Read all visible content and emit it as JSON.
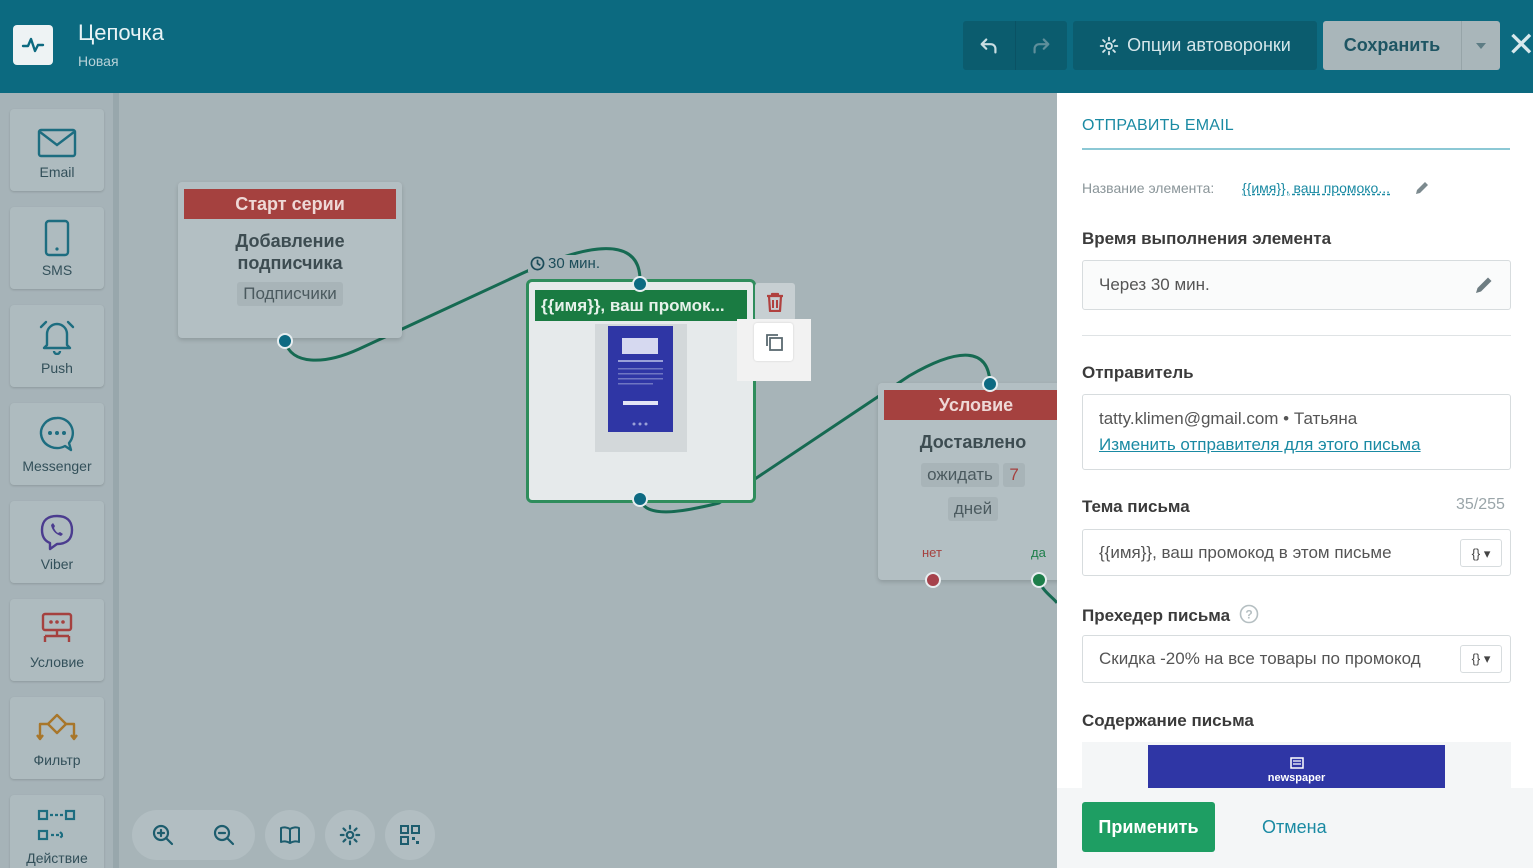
{
  "header": {
    "title": "Цепочка",
    "subtitle": "Новая",
    "options_label": "Опции автоворонки",
    "save_label": "Сохранить"
  },
  "sidebar": {
    "items": [
      {
        "label": "Email",
        "icon": "envelope-icon"
      },
      {
        "label": "SMS",
        "icon": "phone-icon"
      },
      {
        "label": "Push",
        "icon": "bell-icon"
      },
      {
        "label": "Messenger",
        "icon": "chat-bubble-icon"
      },
      {
        "label": "Viber",
        "icon": "viber-icon"
      },
      {
        "label": "Условие",
        "icon": "condition-icon"
      },
      {
        "label": "Фильтр",
        "icon": "filter-icon"
      },
      {
        "label": "Действие",
        "icon": "action-icon"
      }
    ]
  },
  "canvas": {
    "start_node": {
      "header": "Старт серии",
      "title": "Добавление подписчика",
      "chip": "Подписчики"
    },
    "email_node": {
      "timer": "30 мин.",
      "header": "{{имя}}, ваш промок..."
    },
    "condition_node": {
      "header": "Условие",
      "title": "Доставлено",
      "wait_label": "ожидать",
      "wait_value": "7",
      "wait_unit": "дней",
      "no_label": "нет",
      "yes_label": "да"
    }
  },
  "panel": {
    "title": "ОТПРАВИТЬ EMAIL",
    "element_name_label": "Название элемента:",
    "element_name_value": "{{имя}}, ваш промоко...",
    "exec_time_label": "Время выполнения элемента",
    "exec_time_value": "Через 30 мин.",
    "sender_label": "Отправитель",
    "sender_value": "tatty.klimen@gmail.com • Татьяна",
    "sender_change_link": "Изменить отправителя для этого письма",
    "subject_label": "Тема письма",
    "subject_counter": "35/255",
    "subject_value": "{{имя}}, ваш промокод в этом письме",
    "preheader_label": "Прехедер письма",
    "preheader_value": "Скидка -20% на все товары по промокод",
    "content_label": "Содержание письма",
    "preview_brand": "newspaper",
    "apply_label": "Применить",
    "cancel_label": "Отмена"
  },
  "colors": {
    "header_bg": "#0c6a80",
    "accent": "#1a8aa3",
    "apply_green": "#1e9e63",
    "start_red": "#a5413f",
    "email_green": "#1a7b42"
  }
}
